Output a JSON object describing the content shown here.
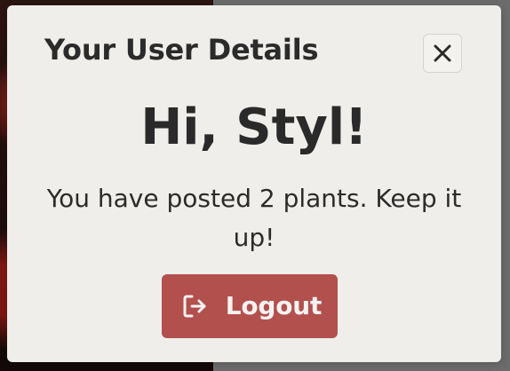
{
  "modal": {
    "title": "Your User Details",
    "greeting": "Hi, Styl!",
    "message": "You have posted 2 plants. Keep it up!",
    "logout_label": "Logout",
    "icons": {
      "close": "close-icon",
      "logout": "logout-icon"
    }
  },
  "colors": {
    "modal_background": "#efeeea",
    "logout_button": "#b2504d",
    "text_dark": "#2b2b2b",
    "backdrop": "#6c6c6c"
  }
}
